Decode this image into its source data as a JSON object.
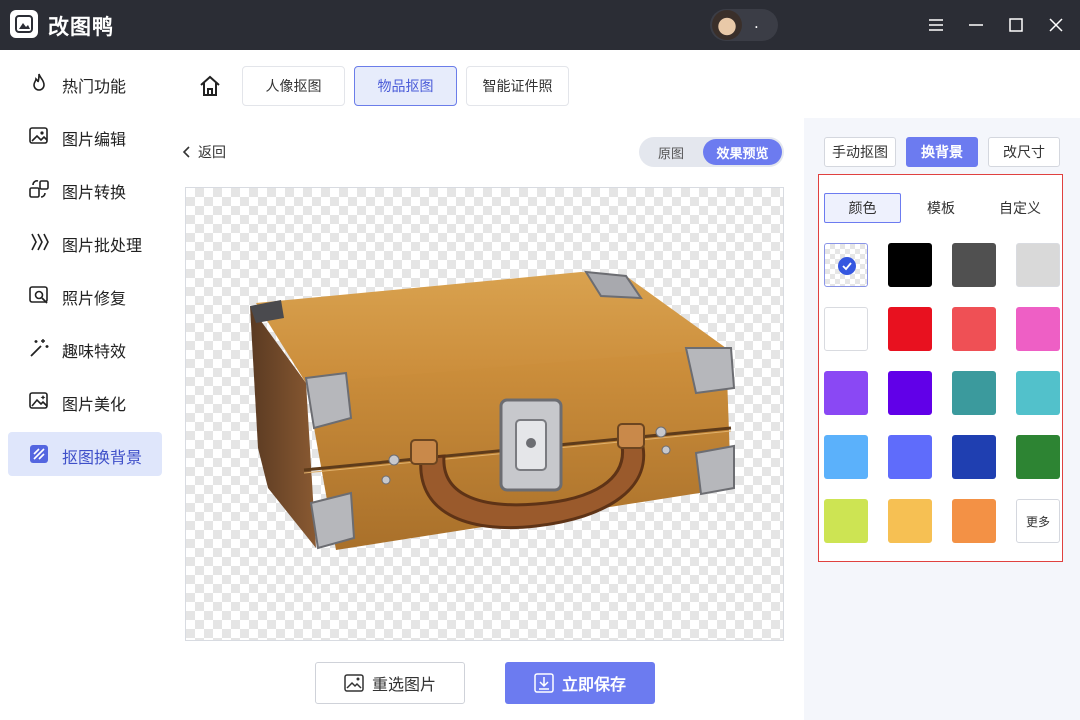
{
  "app": {
    "title": "改图鸭",
    "user_name": "."
  },
  "sidebar": {
    "items": [
      {
        "label": "热门功能",
        "icon": "flame-icon"
      },
      {
        "label": "图片编辑",
        "icon": "image-edit-icon"
      },
      {
        "label": "图片转换",
        "icon": "convert-icon"
      },
      {
        "label": "图片批处理",
        "icon": "batch-icon"
      },
      {
        "label": "照片修复",
        "icon": "photo-repair-icon"
      },
      {
        "label": "趣味特效",
        "icon": "magic-wand-icon"
      },
      {
        "label": "图片美化",
        "icon": "beautify-icon"
      },
      {
        "label": "抠图换背景",
        "icon": "cutout-icon"
      }
    ],
    "active_index": 7
  },
  "tabs": {
    "items": [
      "人像抠图",
      "物品抠图",
      "智能证件照"
    ],
    "active_index": 1
  },
  "center": {
    "back_label": "返回",
    "toggle": {
      "original": "原图",
      "preview": "效果预览"
    },
    "reselect_label": "重选图片",
    "save_label": "立即保存"
  },
  "right": {
    "modes": [
      "手动抠图",
      "换背景",
      "改尺寸"
    ],
    "active_mode": 1,
    "sub_tabs": [
      "颜色",
      "模板",
      "自定义"
    ],
    "active_sub_tab": 0,
    "colors": [
      "transparent",
      "#000000",
      "#505050",
      "#d9d9d9",
      "#ffffff",
      "#e8111f",
      "#ef5055",
      "#ee5fc5",
      "#8a48f4",
      "#6100e8",
      "#3b9a9d",
      "#52c1cb",
      "#5bb1fb",
      "#5f6cfb",
      "#1f3fb1",
      "#2d8433",
      "#cde453",
      "#f6c053",
      "#f39145",
      "more"
    ],
    "selected_color_index": 0,
    "more_label": "更多"
  },
  "colors": {
    "accent": "#6c7bf0",
    "titlebar": "#2b2d35",
    "highlight_border": "#e0413f"
  }
}
